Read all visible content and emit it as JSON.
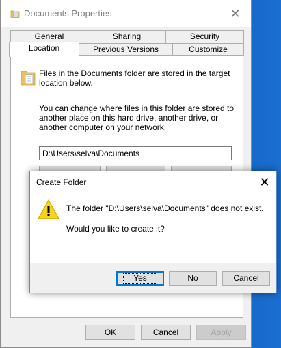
{
  "window": {
    "title": "Documents Properties",
    "tabs_row1": [
      "General",
      "Sharing",
      "Security"
    ],
    "tabs_row2": [
      "Location",
      "Previous Versions",
      "Customize"
    ],
    "active_tab": "Location"
  },
  "location": {
    "info": "Files in the Documents folder are stored in the target location below.",
    "description": "You can change where files in this folder are stored to another place on this hard drive, another drive, or another computer on your network.",
    "path_value": "D:\\Users\\selva\\Documents"
  },
  "buttons": {
    "ok": "OK",
    "cancel": "Cancel",
    "apply": "Apply"
  },
  "dialog": {
    "title": "Create Folder",
    "message": "The folder \"D:\\Users\\selva\\Documents\" does not exist.",
    "question": "Would you like to create it?",
    "yes_label": "Yes",
    "no_label": "No",
    "cancel_label": "Cancel"
  },
  "colors": {
    "accent": "#0078d7",
    "warning": "#f7d21e",
    "folder": "#e8c163"
  },
  "icons": {
    "title": "folder-documents-icon",
    "location": "folder-documents-icon",
    "dialog": "warning-icon"
  }
}
